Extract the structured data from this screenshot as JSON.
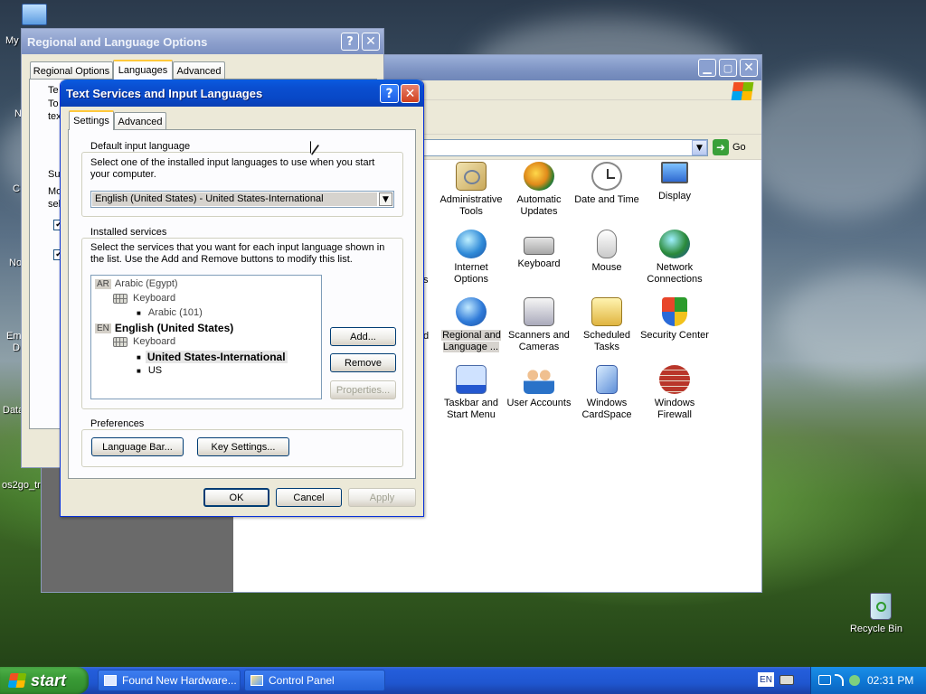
{
  "desktop": {
    "icons": [
      {
        "label": "My"
      },
      {
        "label": "N"
      },
      {
        "label": "C"
      },
      {
        "label": "No"
      },
      {
        "label": "Em"
      },
      {
        "label": "D"
      },
      {
        "label": "Data"
      },
      {
        "label": "os2go_tr"
      },
      {
        "label": "Recycle Bin"
      }
    ]
  },
  "regional_window": {
    "title": "Regional and Language Options",
    "tabs": [
      "Regional Options",
      "Languages",
      "Advanced"
    ],
    "partial_texts": [
      "Te",
      "To",
      "tex",
      "Su",
      "Mo",
      "sel"
    ]
  },
  "control_panel": {
    "go_label": "Go",
    "items": [
      {
        "label": "Administrative Tools",
        "icon": "admin-tools-icon"
      },
      {
        "label": "Automatic Updates",
        "icon": "automatic-updates-icon"
      },
      {
        "label": "Date and Time",
        "icon": "date-time-icon"
      },
      {
        "label": "Display",
        "icon": "display-icon"
      },
      {
        "label": "Internet Options",
        "icon": "internet-options-icon"
      },
      {
        "label": "Keyboard",
        "icon": "keyboard-icon"
      },
      {
        "label": "Mouse",
        "icon": "mouse-icon"
      },
      {
        "label": "Network Connections",
        "icon": "network-connections-icon"
      },
      {
        "label": "Regional and Language ...",
        "icon": "regional-language-icon"
      },
      {
        "label": "Scanners and Cameras",
        "icon": "scanners-cameras-icon"
      },
      {
        "label": "Scheduled Tasks",
        "icon": "scheduled-tasks-icon"
      },
      {
        "label": "Security Center",
        "icon": "security-center-icon"
      },
      {
        "label": "Taskbar and Start Menu",
        "icon": "taskbar-start-icon"
      },
      {
        "label": "User Accounts",
        "icon": "user-accounts-icon"
      },
      {
        "label": "Windows CardSpace",
        "icon": "cardspace-icon"
      },
      {
        "label": "Windows Firewall",
        "icon": "firewall-icon"
      }
    ],
    "partial_left": [
      "s",
      "d"
    ]
  },
  "tsil": {
    "title": "Text Services and Input Languages",
    "tabs": [
      "Settings",
      "Advanced"
    ],
    "default_group": "Default input language",
    "default_desc": "Select one of the installed input languages to use when you start your computer.",
    "default_value": "English (United States) - United States-International",
    "installed_group": "Installed services",
    "installed_desc": "Select the services that you want for each input language shown in the list. Use the Add and Remove buttons to modify this list.",
    "tree": {
      "ar_code": "AR",
      "ar_lang": "Arabic (Egypt)",
      "ar_kb": "Keyboard",
      "ar_layout": "Arabic (101)",
      "en_code": "EN",
      "en_lang": "English (United States)",
      "en_kb": "Keyboard",
      "en_layout1": "United States-International",
      "en_layout2": "US"
    },
    "buttons": {
      "add": "Add...",
      "remove": "Remove",
      "properties": "Properties..."
    },
    "prefs_group": "Preferences",
    "language_bar": "Language Bar...",
    "key_settings": "Key Settings...",
    "ok": "OK",
    "cancel": "Cancel",
    "apply": "Apply"
  },
  "taskbar": {
    "start": "start",
    "tasks": [
      "Found New Hardware...",
      "Control Panel"
    ],
    "lang": "EN",
    "clock": "02:31 PM"
  },
  "colors": {
    "xp_blue": "#0a59d6",
    "inactive_title": "#8c9bbd",
    "close_red": "#e04525",
    "start_green": "#3a9b36",
    "tray_blue": "#0f8fe0"
  }
}
